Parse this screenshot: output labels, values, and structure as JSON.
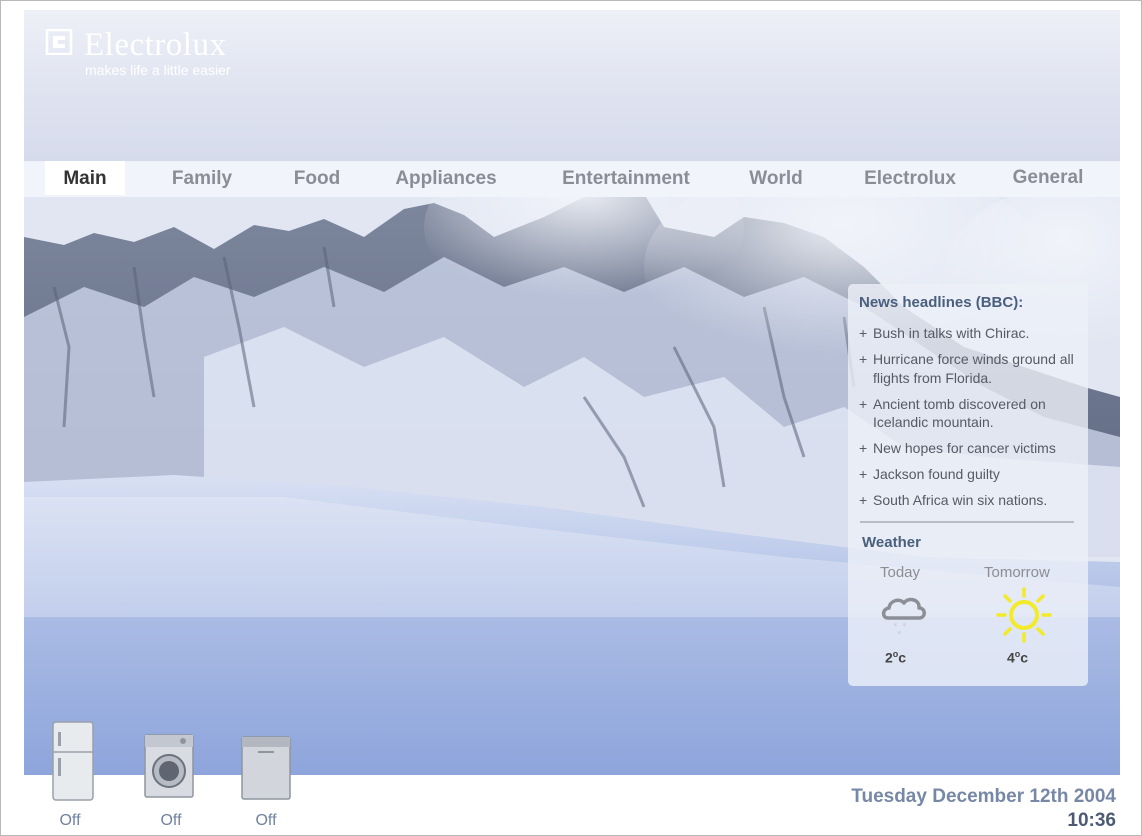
{
  "brand": {
    "name": "Electrolux",
    "tagline": "makes life a little easier"
  },
  "nav": {
    "items": [
      {
        "label": "Main",
        "active": true
      },
      {
        "label": "Family",
        "active": false
      },
      {
        "label": "Food",
        "active": false
      },
      {
        "label": "Appliances",
        "active": false
      },
      {
        "label": "Entertainment",
        "active": false
      },
      {
        "label": "World",
        "active": false
      },
      {
        "label": "Electrolux",
        "active": false
      },
      {
        "label": "General",
        "active": false
      }
    ]
  },
  "news": {
    "title": "News headlines (BBC):",
    "bullet": "+",
    "items": [
      "Bush in talks with Chirac.",
      "Hurricane force winds ground all flights from Florida.",
      "Ancient tomb discovered on Icelandic mountain.",
      "New hopes for cancer victims",
      "Jackson found guilty",
      "South Africa win six nations."
    ]
  },
  "weather": {
    "title": "Weather",
    "today": {
      "label": "Today",
      "temp": "2",
      "unit": "o",
      "unit_suffix": "c",
      "icon": "snow-cloud-icon"
    },
    "tomorrow": {
      "label": "Tomorrow",
      "temp": "4",
      "unit": "o",
      "unit_suffix": "c",
      "icon": "sun-icon"
    }
  },
  "appliances": [
    {
      "name": "fridge",
      "icon": "fridge-icon",
      "state": "Off"
    },
    {
      "name": "washing-machine",
      "icon": "washing-machine-icon",
      "state": "Off"
    },
    {
      "name": "dishwasher",
      "icon": "dishwasher-icon",
      "state": "Off"
    }
  ],
  "status": {
    "date": "Tuesday December 12th 2004",
    "time": "10:36"
  },
  "colors": {
    "accent": "#4a5f7d",
    "sun": "#f2ea2a",
    "state_text": "#6f82a0"
  }
}
